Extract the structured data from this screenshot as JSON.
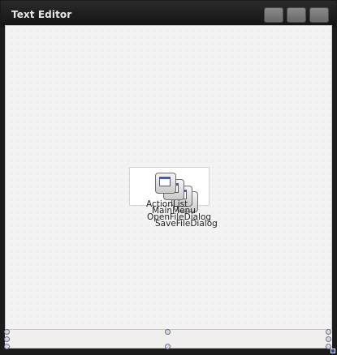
{
  "window": {
    "title": "Text Editor"
  },
  "title_buttons": [
    "minimize",
    "maximize",
    "close"
  ],
  "components": [
    {
      "label": "ActionList"
    },
    {
      "label": "MainMenu"
    },
    {
      "label": "OpenFileDialog"
    },
    {
      "label": "SaveFileDialog"
    }
  ],
  "colors": {
    "titlebar": "#1c1c1c",
    "client": "#f3f3f3",
    "tray": "#f1eeee"
  }
}
